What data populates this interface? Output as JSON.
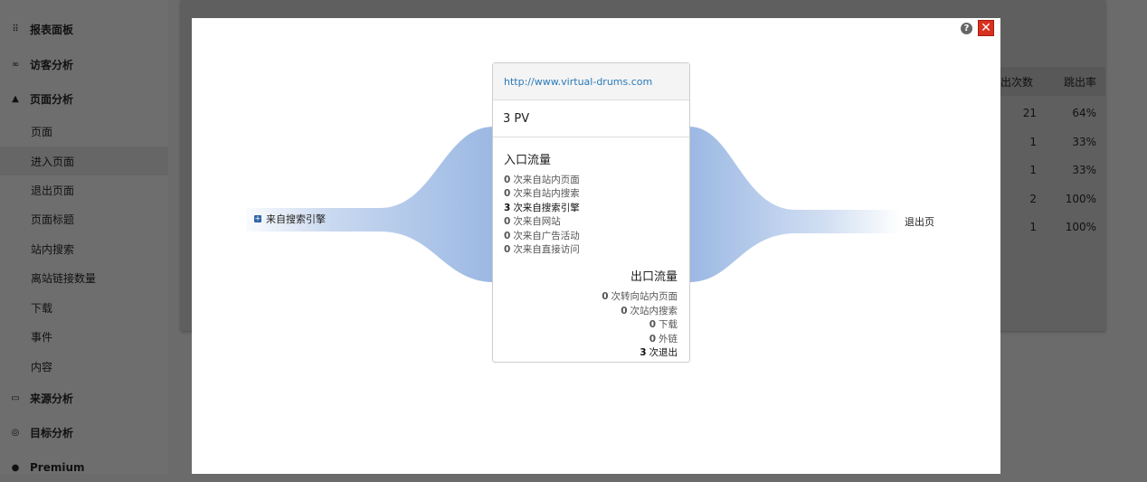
{
  "sidebar": {
    "items": [
      {
        "label": "报表面板",
        "icon": "grid-icon",
        "type": "main"
      },
      {
        "label": "访客分析",
        "icon": "binoculars-icon",
        "type": "main"
      },
      {
        "label": "页面分析",
        "icon": "bell-icon",
        "type": "main"
      },
      {
        "label": "页面",
        "type": "sub"
      },
      {
        "label": "进入页面",
        "type": "sub",
        "active": true
      },
      {
        "label": "退出页面",
        "type": "sub"
      },
      {
        "label": "页面标题",
        "type": "sub"
      },
      {
        "label": "站内搜索",
        "type": "sub"
      },
      {
        "label": "离站链接数量",
        "type": "sub"
      },
      {
        "label": "下载",
        "type": "sub"
      },
      {
        "label": "事件",
        "type": "sub"
      },
      {
        "label": "内容",
        "type": "sub"
      },
      {
        "label": "来源分析",
        "icon": "window-icon",
        "type": "main"
      },
      {
        "label": "目标分析",
        "icon": "target-icon",
        "type": "main"
      },
      {
        "label": "Premium",
        "icon": "premium-icon",
        "type": "main"
      }
    ]
  },
  "bg_table": {
    "headers": [
      "出次数",
      "跳出率"
    ],
    "rows": [
      [
        "21",
        "64%"
      ],
      [
        "1",
        "33%"
      ],
      [
        "1",
        "33%"
      ],
      [
        "2",
        "100%"
      ],
      [
        "1",
        "100%"
      ]
    ]
  },
  "modal": {
    "help_icon": "?",
    "close_icon": "✕",
    "source_label": "来自搜索引擎",
    "exit_label": "退出页",
    "card": {
      "url": "http://www.virtual-drums.com",
      "pv": "3 PV",
      "entry_title": "入口流量",
      "entry_lines": [
        {
          "n": "0",
          "t": "次来自站内页面"
        },
        {
          "n": "0",
          "t": "次来自站内搜索"
        },
        {
          "n": "3",
          "t": "次来自搜索引擎",
          "strong": true
        },
        {
          "n": "0",
          "t": "次来自网站"
        },
        {
          "n": "0",
          "t": "次来自广告活动"
        },
        {
          "n": "0",
          "t": "次来自直接访问"
        }
      ],
      "exit_title": "出口流量",
      "exit_lines": [
        {
          "n": "0",
          "t": "次转向站内页面"
        },
        {
          "n": "0",
          "t": "次站内搜索"
        },
        {
          "n": "0",
          "t": "下载"
        },
        {
          "n": "0",
          "t": "外链"
        },
        {
          "n": "3",
          "t": "次退出",
          "strong": true
        }
      ]
    }
  },
  "colors": {
    "flow": "#9bb8e3",
    "link": "#2a7ab8",
    "close": "#d9301f"
  }
}
